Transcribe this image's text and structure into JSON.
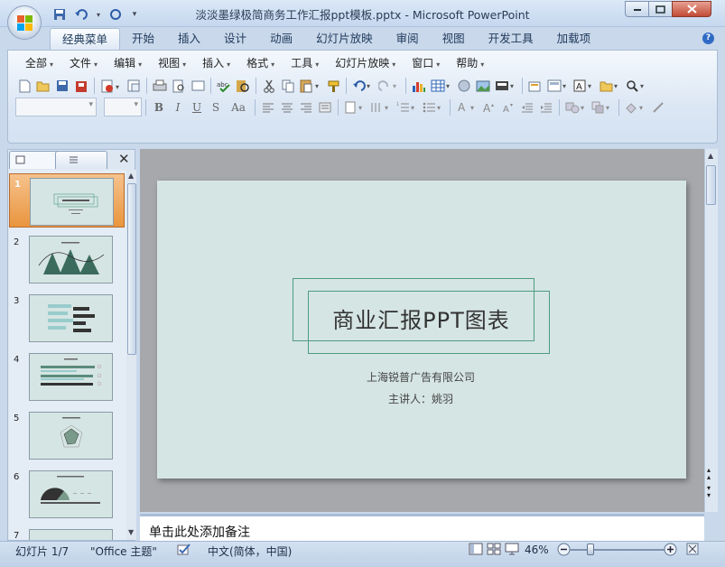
{
  "window": {
    "title": "淡淡墨绿极简商务工作汇报ppt模板.pptx - Microsoft PowerPoint"
  },
  "ribbon_tabs": [
    "经典菜单",
    "开始",
    "插入",
    "设计",
    "动画",
    "幻灯片放映",
    "审阅",
    "视图",
    "开发工具",
    "加载项"
  ],
  "menus": [
    "全部",
    "文件",
    "编辑",
    "视图",
    "插入",
    "格式",
    "工具",
    "幻灯片放映",
    "窗口",
    "帮助"
  ],
  "format_buttons": [
    "B",
    "I",
    "U",
    "S",
    "Aa"
  ],
  "thumbnails": [
    {
      "num": "1",
      "selected": true
    },
    {
      "num": "2",
      "selected": false
    },
    {
      "num": "3",
      "selected": false
    },
    {
      "num": "4",
      "selected": false
    },
    {
      "num": "5",
      "selected": false
    },
    {
      "num": "6",
      "selected": false
    },
    {
      "num": "7",
      "selected": false
    }
  ],
  "slide": {
    "title": "商业汇报PPT图表",
    "company": "上海锐普广告有限公司",
    "presenter": "主讲人：姚羽",
    "background_color": "#d5e5e3",
    "accent_color": "#4f9b80"
  },
  "notes": {
    "placeholder": "单击此处添加备注"
  },
  "statusbar": {
    "slide_info": "幻灯片 1/7",
    "theme": "\"Office 主题\"",
    "language": "中文(简体，中国)",
    "zoom": "46%",
    "zoom_level": 0.46
  },
  "colors": {
    "selected_thumb": "#e9953d",
    "ribbon_bg": "#dce7f4"
  }
}
